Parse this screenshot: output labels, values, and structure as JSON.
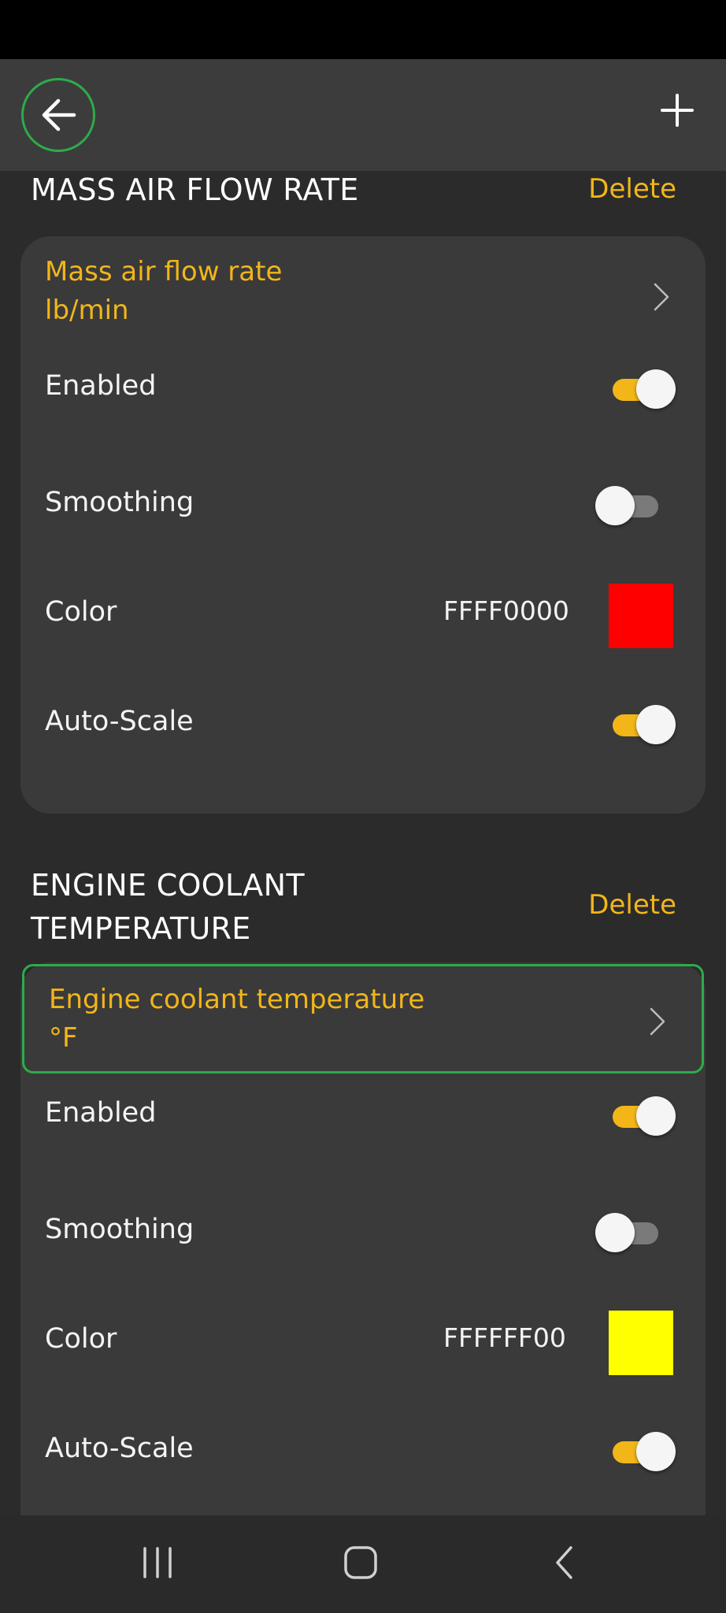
{
  "header": {
    "back_icon": "arrow-left-icon",
    "add_icon": "plus-icon"
  },
  "sections": [
    {
      "title": "MASS AIR FLOW RATE",
      "delete_label": "Delete",
      "param_name": "Mass air flow rate",
      "param_unit": "lb/min",
      "enabled_label": "Enabled",
      "enabled": true,
      "smoothing_label": "Smoothing",
      "smoothing": false,
      "color_label": "Color",
      "color_hex": "FFFF0000",
      "color_value": "#ff0000",
      "autoscale_label": "Auto-Scale",
      "autoscale": true
    },
    {
      "title": "ENGINE COOLANT TEMPERATURE",
      "delete_label": "Delete",
      "param_name": "Engine coolant temperature",
      "param_unit": "°F",
      "enabled_label": "Enabled",
      "enabled": true,
      "smoothing_label": "Smoothing",
      "smoothing": false,
      "color_label": "Color",
      "color_hex": "FFFFFF00",
      "color_value": "#ffff00",
      "autoscale_label": "Auto-Scale",
      "autoscale": true
    }
  ],
  "colors": {
    "accent": "#f2b619",
    "focus": "#2eab4a",
    "card": "#3a3a3a",
    "background": "#2b2b2b"
  },
  "nav": {
    "recents_icon": "recents-icon",
    "home_icon": "home-icon",
    "back_icon": "nav-back-icon"
  }
}
